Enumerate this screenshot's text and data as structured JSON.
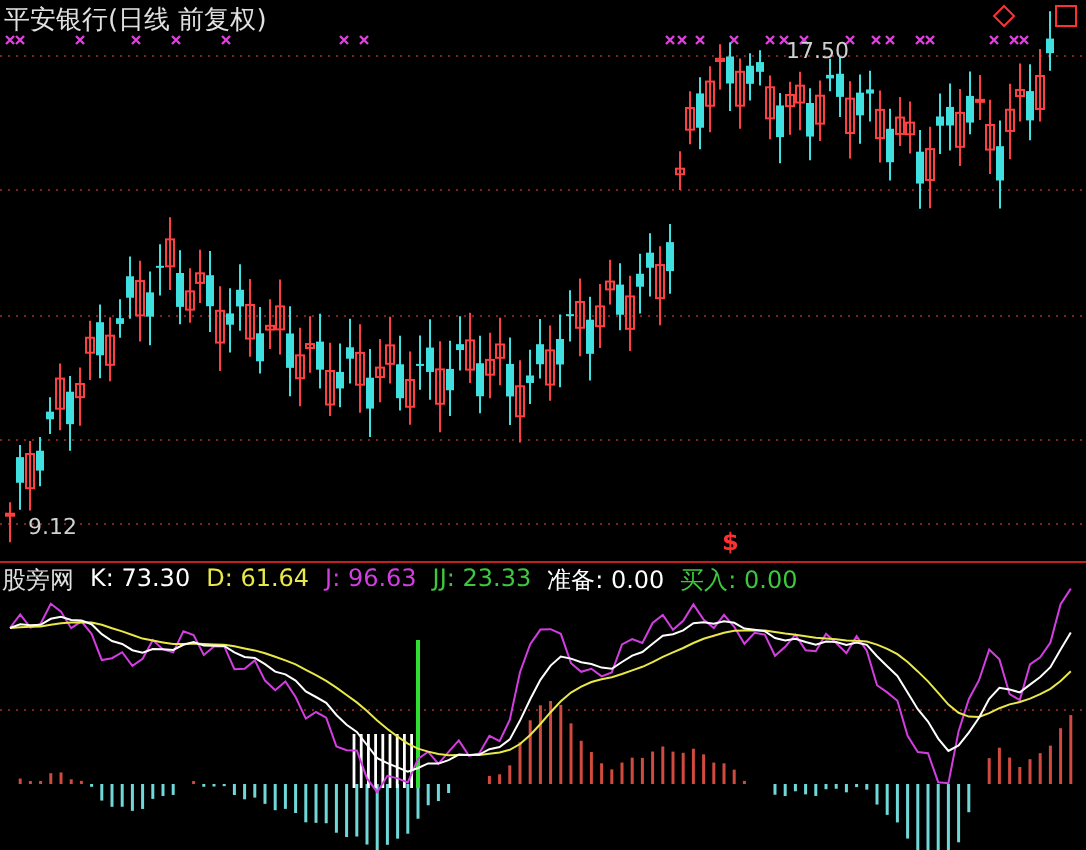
{
  "chart": {
    "title": "平安银行(日线 前复权)",
    "high_label": "17.50",
    "low_label": "9.12",
    "signal_mark": "$"
  },
  "indicator": {
    "name": "股旁网",
    "values": [
      {
        "label": "K: 73.30",
        "color": "#ffffff"
      },
      {
        "label": "D: 61.64",
        "color": "#e8e84a"
      },
      {
        "label": "J: 96.63",
        "color": "#d23ee0"
      },
      {
        "label": "JJ: 23.33",
        "color": "#3ec83e"
      },
      {
        "label": "准备: 0.00",
        "color": "#ffffff"
      },
      {
        "label": "买入: 0.00",
        "color": "#3ec83e"
      }
    ]
  }
}
